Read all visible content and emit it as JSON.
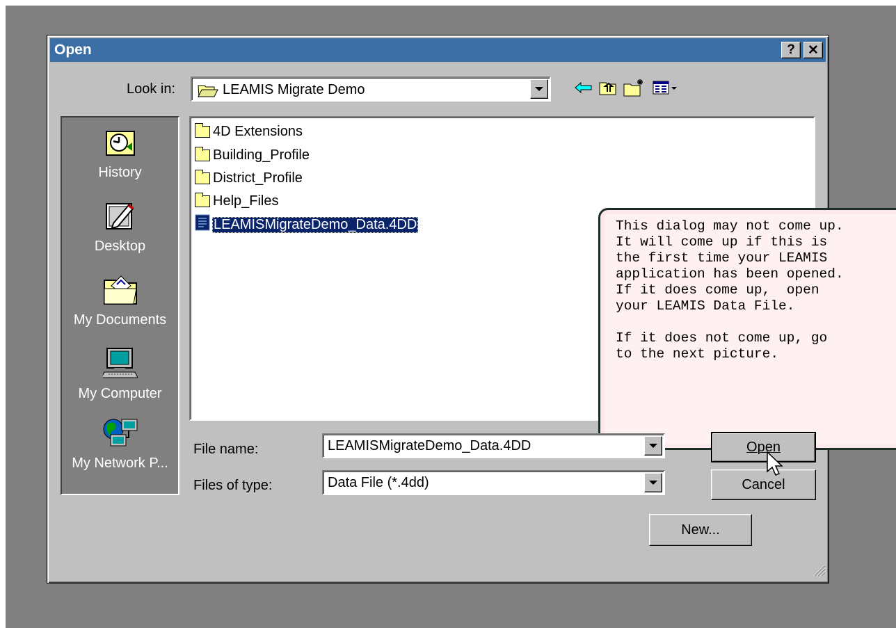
{
  "dialog": {
    "title": "Open",
    "help_label": "?",
    "close_label": "✕"
  },
  "lookin": {
    "label": "Look in:",
    "value": "LEAMIS Migrate Demo"
  },
  "places": [
    {
      "label": "History",
      "icon": "history-icon"
    },
    {
      "label": "Desktop",
      "icon": "desktop-icon"
    },
    {
      "label": "My Documents",
      "icon": "my-documents-icon"
    },
    {
      "label": "My Computer",
      "icon": "my-computer-icon"
    },
    {
      "label": "My Network P...",
      "icon": "network-places-icon"
    }
  ],
  "files": [
    {
      "name": "4D Extensions",
      "type": "folder"
    },
    {
      "name": "Building_Profile",
      "type": "folder"
    },
    {
      "name": "District_Profile",
      "type": "folder"
    },
    {
      "name": "Help_Files",
      "type": "folder"
    },
    {
      "name": "LEAMISMigrateDemo_Data.4DD",
      "type": "data-file",
      "selected": true
    }
  ],
  "note": {
    "text": "This dialog may not come up.\nIt will come up if this is\nthe first time your LEAMIS\napplication has been opened.\nIf it does come up,  open\nyour LEAMIS Data File.\n\nIf it does not come up, go\nto the next picture."
  },
  "filename": {
    "label": "File name:",
    "value": "LEAMISMigrateDemo_Data.4DD"
  },
  "filetype": {
    "label": "Files of type:",
    "value": "Data File (*.4dd)"
  },
  "buttons": {
    "open": "Open",
    "cancel": "Cancel",
    "new": "New..."
  },
  "colors": {
    "titlebar": "#3a6ea5",
    "selection": "#0a246a",
    "face": "#c0c0c0",
    "note_bg": "#fff0f2"
  }
}
